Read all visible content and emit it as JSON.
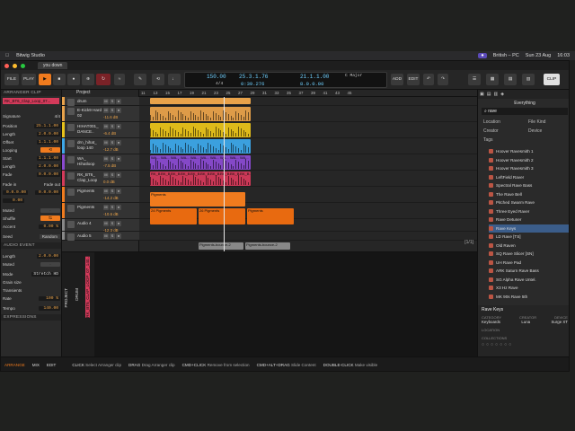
{
  "menubar": {
    "app": "Bitwig Studio",
    "items": [
      "British – PC",
      "Sun 23 Aug",
      "16:03"
    ]
  },
  "tabbar": {
    "doc_tab": "you down"
  },
  "toolbar": {
    "file": "FILE",
    "play": "PLAY",
    "add": "ADD",
    "edit": "EDIT",
    "clip": "CLIP"
  },
  "transport": {
    "tempo": "150.00",
    "tsig": "4/4",
    "position": "25.3.1.76",
    "time": "0:39.276",
    "loop_start": "21.1.1.00",
    "loop_len": "8.0.0.00",
    "key": "C Major"
  },
  "inspector": {
    "header": "ARRANGER CLIP",
    "clip_name": "RK_BT6_Clap_Loop_07...",
    "signature_label": "Signature",
    "signature": "4/4",
    "rows": [
      {
        "label": "Position",
        "value": "25.1.1.00"
      },
      {
        "label": "Length",
        "value": "2.0.0.00"
      },
      {
        "label": "Offset",
        "value": "1.1.1.00"
      },
      {
        "label": "Looping",
        "value": ""
      },
      {
        "label": "Start",
        "value": "1.1.1.00"
      },
      {
        "label": "Length",
        "value": "2.0.0.00"
      },
      {
        "label": "Fade",
        "value": "0.0.0.00"
      }
    ],
    "fade_in": "Fade in",
    "fade_out": "Fade out",
    "fade_in_val": "0.0.0.00",
    "fade_out_val": "0.0.0.00",
    "level": "0.00",
    "muted": "Muted",
    "shuffle": "Shuffle",
    "accent": "Accent",
    "accent_val": "0.00 %",
    "seed": "Seed",
    "random": "Random",
    "audio_header": "AUDIO EVENT",
    "length": "Length",
    "length_val": "2.0.0.00",
    "muted2": "Muted",
    "mode": "Mode",
    "mode_val": "Stretch HD",
    "grain": "Grain size",
    "grain_val": "",
    "transients": "Transients",
    "rate": "Rate",
    "rate_val": "100 %",
    "tempo": "Tempo",
    "tempo_val": "140.00",
    "expressions": "EXPRESSIONS"
  },
  "tracks": [
    {
      "name": "drum",
      "vol": "-12.4dB",
      "color": "#e8a24a"
    },
    {
      "name": "E-Kick9 Hard 02",
      "vol": "-11.6 dB",
      "color": "#e8a24a"
    },
    {
      "name": "HIHAT001_ DANCE..",
      "vol": "-6.4 dB",
      "color": "#e8c21a"
    },
    {
      "name": "drn_hihat_ loop 140",
      "vol": "-12.7 dB",
      "color": "#3da7e8"
    },
    {
      "name": "WA_ Hihatloop",
      "vol": "-7.5 dB",
      "color": "#8a4ad0"
    },
    {
      "name": "RK_BT6_ Clap_Loop",
      "vol": "0.0 dB",
      "color": "#d43a5a"
    },
    {
      "name": "Pigments",
      "vol": "-14.2 dB",
      "color": "#f07b1e"
    },
    {
      "name": "Pigments",
      "vol": "-10.6 dB",
      "color": "#f07b1e"
    },
    {
      "name": "Audio 4",
      "vol": "-12.3 dB",
      "color": "#888"
    },
    {
      "name": "Audio 5",
      "vol": "",
      "color": "#888"
    }
  ],
  "ruler": [
    "11",
    "13",
    "15",
    "17",
    "19",
    "21",
    "23",
    "25",
    "27",
    "29",
    "31",
    "33",
    "35",
    "37",
    "39",
    "41",
    "43",
    "45"
  ],
  "clips": {
    "wa": "WA...",
    "rk": "RK_B...",
    "pig1": "24 Pigments",
    "pig2": "26 Pigments",
    "pig3": "Pigments",
    "bounce1": "Pigments-bounce-2",
    "bounce2": "Pigments-bounce-2"
  },
  "detail": {
    "project": "PROJECT",
    "track": "DRUM",
    "clip": "RK_BT6_CLAP_LOOP_07_140..",
    "count": "[1/1]"
  },
  "browser": {
    "title": "Everything",
    "search": "rave",
    "filters": [
      "Location",
      "File Kind",
      "Creator",
      "Device",
      "Tags"
    ],
    "items": [
      "Hoover Ravesmith 1",
      "Hoover Ravesmith 2",
      "Hoover Ravesmith 3",
      "LeftField Raver",
      "Spectral Rave Bass",
      "The Rave Bell",
      "Pitched Swarm Rave",
      "Three Eyed Raver",
      "Rave Detuner",
      "Rave Keys",
      "LD Rave [TS]",
      "Old Raven",
      "SQ Rave Slicer [SN]",
      "UH Rave Pad",
      "ARK Saturn Rave Bass",
      "SG Alpha Rave Untel.",
      "X3 Hz Rave",
      "MK 90s Rave 5th"
    ],
    "selected": "Rave Keys",
    "meta_name": "Rave Keys",
    "cat_label": "CATEGORY",
    "cat": "Keyboards",
    "creator_label": "CREATOR",
    "creator": "Luna",
    "device_label": "DEVICE",
    "device": "Surge XT",
    "location": "LOCATION",
    "collections": "COLLECTIONS"
  },
  "status": {
    "tabs": [
      "ARRANGE",
      "MIX",
      "EDIT"
    ],
    "hints": [
      [
        "CLICK",
        "Select Arranger clip"
      ],
      [
        "DRAG",
        "Drag Arranger clip"
      ],
      [
        "CMD+CLICK",
        "Remove from selection"
      ],
      [
        "CMD+ALT+DRAG",
        "Slide Content"
      ],
      [
        "DOUBLE-CLICK",
        "Make visible"
      ]
    ]
  }
}
